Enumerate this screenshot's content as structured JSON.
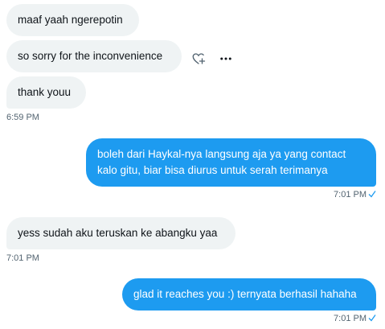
{
  "conversation": {
    "messages": [
      {
        "text": "maaf yaah ngerepotin",
        "direction": "incoming"
      },
      {
        "text": "so sorry for the inconvenience",
        "direction": "incoming"
      },
      {
        "text": "thank youu",
        "direction": "incoming",
        "time": "6:59 PM"
      },
      {
        "text": "boleh dari Haykal-nya langsung aja ya yang contact kalo gitu, biar bisa diurus untuk serah terimanya",
        "direction": "outgoing",
        "time": "7:01 PM",
        "status": "sent"
      },
      {
        "text": "yess sudah aku teruskan ke abangku yaa",
        "direction": "incoming",
        "time": "7:01 PM"
      },
      {
        "text": "glad it reaches you :) ternyata berhasil hahaha",
        "direction": "outgoing",
        "time": "7:01 PM",
        "status": "sent"
      }
    ]
  },
  "actions": {
    "react_icon": "heart-plus-icon",
    "more_icon": "more-horizontal-icon"
  },
  "colors": {
    "incoming_bubble": "#eff3f4",
    "outgoing_bubble": "#1d9bf0",
    "timestamp": "#536471",
    "checkmark": "#1d9bf0"
  }
}
